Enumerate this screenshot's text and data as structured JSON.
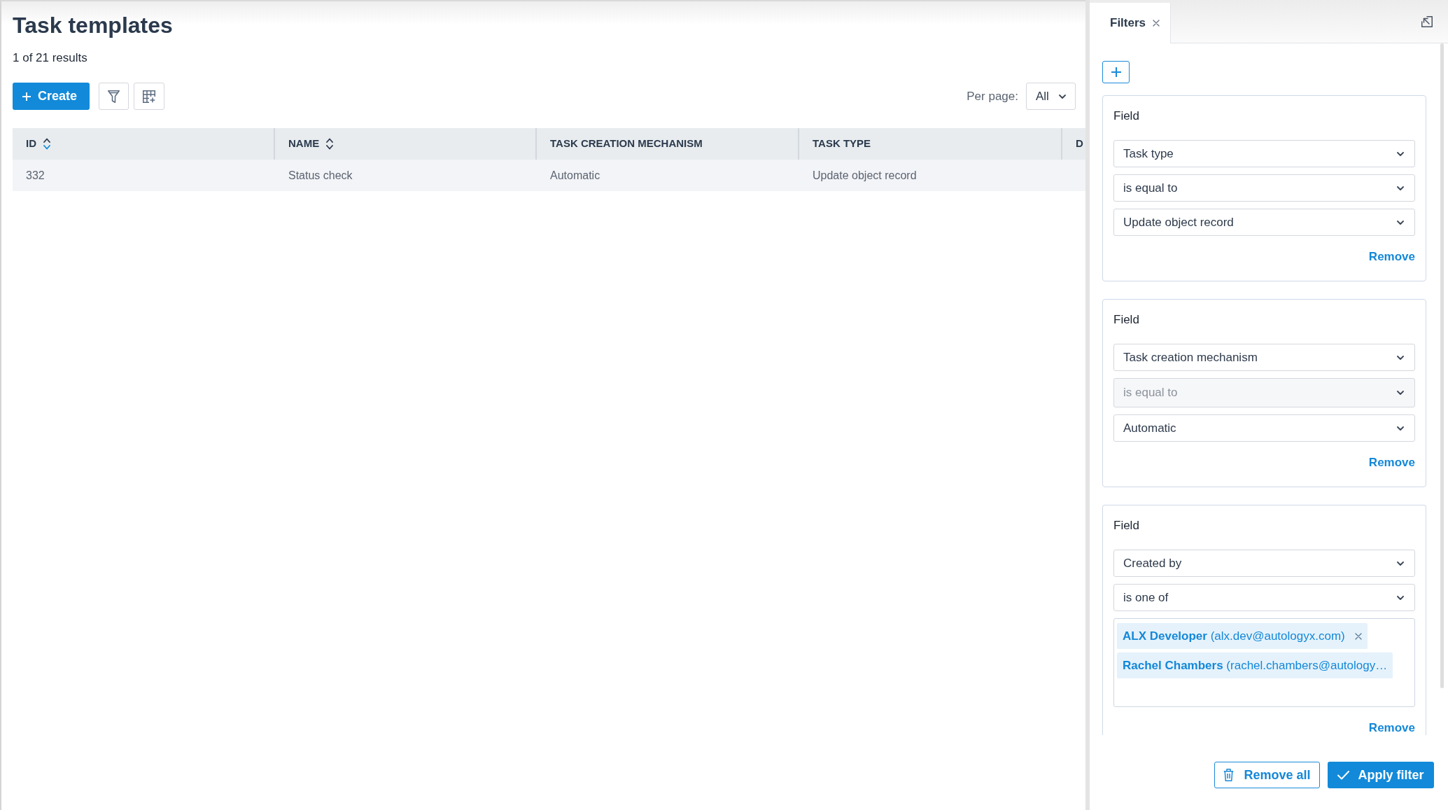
{
  "page": {
    "title": "Task templates",
    "results": "1 of 21 results"
  },
  "toolbar": {
    "create_button": "Create",
    "per_page": {
      "label": "Per page:",
      "value": "All"
    }
  },
  "table": {
    "columns": [
      {
        "label": "ID",
        "sortable": true,
        "sorted_descending": true
      },
      {
        "label": "NAME",
        "sortable": true,
        "sorted_descending": false
      },
      {
        "label": "TASK CREATION MECHANISM",
        "sortable": false
      },
      {
        "label": "TASK TYPE",
        "sortable": false
      },
      {
        "label": "D"
      }
    ],
    "rows": [
      {
        "cells": [
          "332",
          "Status check",
          "Automatic",
          "Update object record"
        ]
      }
    ]
  },
  "filter_panel": {
    "tabs": [
      {
        "label": "Filters",
        "selected": true
      }
    ],
    "filters": [
      {
        "label": "Field",
        "inputs": [
          {
            "kind": "dropdown",
            "value": "Task type",
            "disabled": false
          },
          {
            "kind": "dropdown",
            "value": "is equal to",
            "disabled": false
          },
          {
            "kind": "dropdown",
            "value": "Update object record",
            "disabled": false
          }
        ],
        "remove": "Remove"
      },
      {
        "label": "Field",
        "inputs": [
          {
            "kind": "dropdown",
            "value": "Task creation mechanism",
            "disabled": false
          },
          {
            "kind": "dropdown",
            "value": "is equal to",
            "disabled": true
          },
          {
            "kind": "dropdown",
            "value": "Automatic",
            "disabled": false
          }
        ],
        "remove": "Remove"
      },
      {
        "label": "Field",
        "inputs": [
          {
            "kind": "dropdown",
            "value": "Created by",
            "disabled": false
          },
          {
            "kind": "dropdown",
            "value": "is one of",
            "disabled": false
          },
          {
            "kind": "tags",
            "tags": [
              {
                "text": "**ALX Developer** (alx.dev@autologyx.com)",
                "removable": true
              },
              {
                "text": "**Rachel Chambers** (rachel.chambers@autology…",
                "removable": false
              }
            ]
          }
        ],
        "remove": "Remove"
      }
    ],
    "remove_all_button": "Remove all",
    "apply_button": "Apply filter"
  }
}
